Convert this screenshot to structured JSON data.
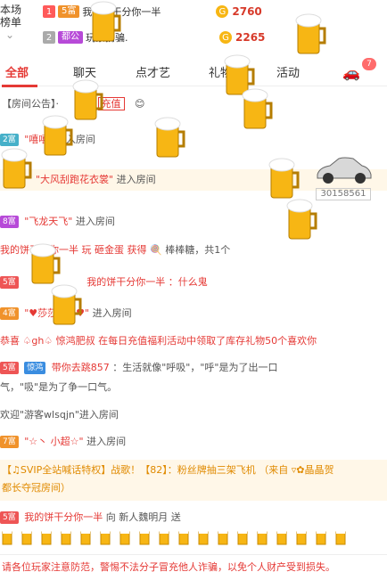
{
  "rank": {
    "side_label": "本场\n榜单",
    "rows": [
      {
        "rank": "1",
        "level": "5富",
        "name": "我的饼干分你一半",
        "score": "2760"
      },
      {
        "rank": "2",
        "level": "都公",
        "name": "玩蒙拐骗.",
        "score": "2265"
      }
    ]
  },
  "tabs": [
    "全部",
    "聊天",
    "点才艺",
    "礼物",
    "活动"
  ],
  "badge": "7",
  "messages": [
    {
      "text": "【房间公告】· ",
      "extra": "充值"
    },
    {
      "level": "2富",
      "name": "\"嘻嘻\"",
      "action": "进入房间"
    },
    {
      "level": "",
      "name": "\"大风刮跑花衣裳\"",
      "action": "进入房间"
    },
    {
      "level": "8富",
      "name": "\"飞龙天飞\"",
      "action": "进入房间"
    },
    {
      "text": "我的饼干分你一半 玩 砸金蛋 获得",
      "gift": "棒棒糖，共1个"
    },
    {
      "level": "5富",
      "name": "我的饼干分你一半",
      "action": "：什么鬼"
    },
    {
      "level": "4富",
      "name": "\"♥莎莎119♥\"",
      "action": "进入房间"
    },
    {
      "text": "恭喜 ♤gh♤ 惊鸿肥叔 在每日充值福利活动中领取了库存礼物50个喜欢你"
    },
    {
      "level": "5富",
      "name": "惊鸿",
      "name2": "带你去跳857",
      "action": "：生活就像\"呼吸\"，\"呼\"是为了出一口"
    },
    {
      "text": "气，\"吸\"是为了争一口气。"
    },
    {
      "text": "欢迎\"游客wlsqjn\"进入房间"
    },
    {
      "level": "7富",
      "name": "\"☆丶 小超☆\"",
      "action": "进入房间"
    },
    {
      "text": "【♫SVIP全站喊话特权】战歌！【82】：粉丝牌抽三架飞机 （来自 ▿✿晶晶贺",
      "text2": "都长夺冠房间）"
    },
    {
      "level": "5富",
      "name": "我的饼干分你一半",
      "action": "向 新人魏明月 送"
    }
  ],
  "car_id": "30158561",
  "footer": "请各位玩家注意防范，警惕不法分子冒充他人诈骗，以免个人财产受到损失。",
  "colors": {
    "accent": "#e53935",
    "gold": "#f7b614"
  }
}
